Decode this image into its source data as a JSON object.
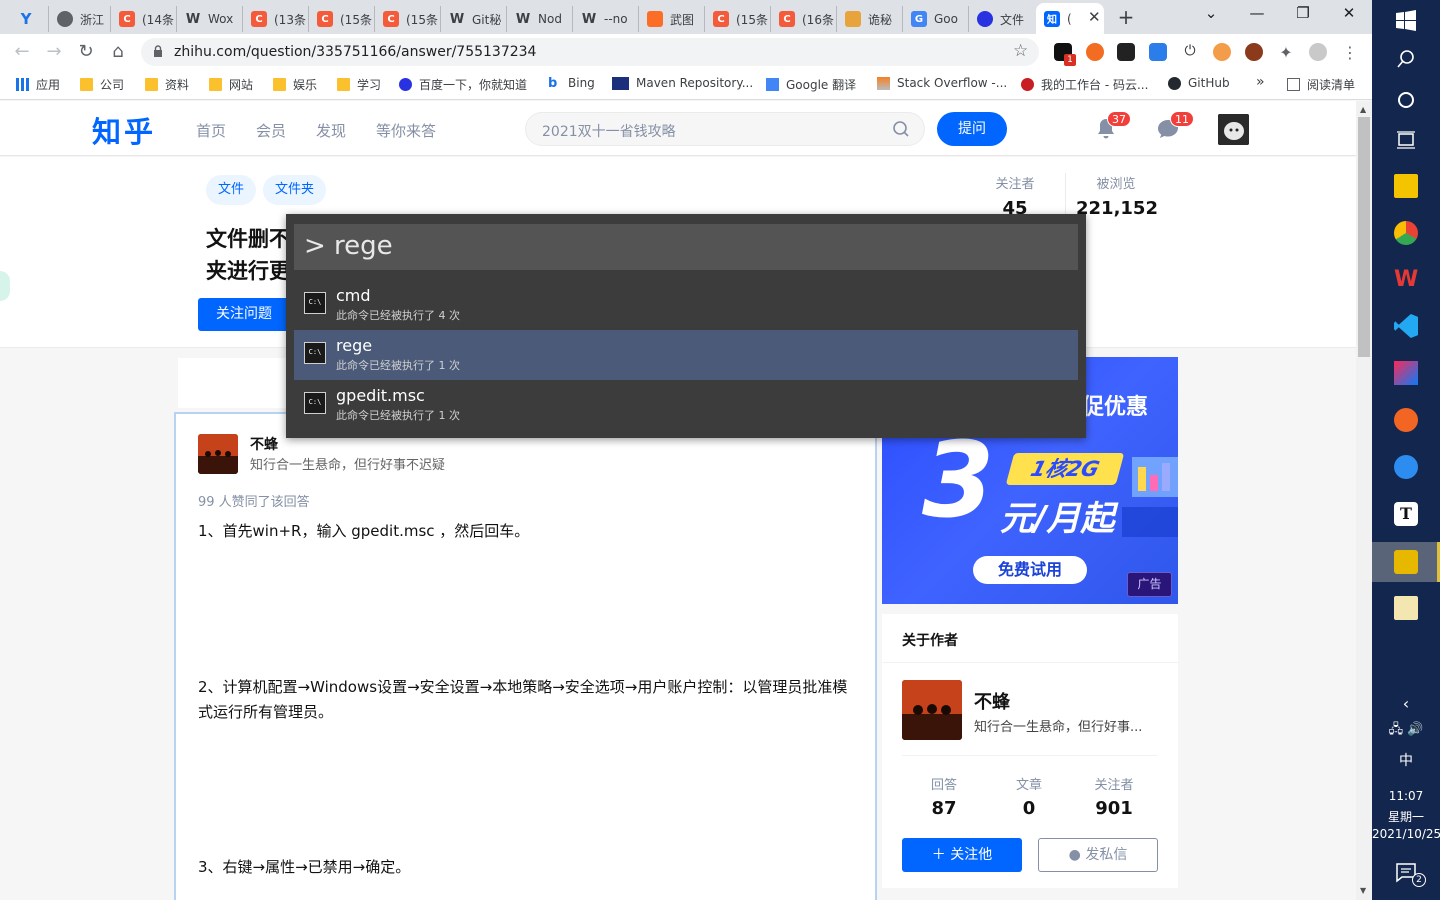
{
  "browser": {
    "tabs": [
      {
        "label": "浙江",
        "icon": "tab-favicon-circle"
      },
      {
        "label": "(14条",
        "icon": "csdn-icon"
      },
      {
        "label": "Wox",
        "icon": "tab-favicon-w"
      },
      {
        "label": "(13条",
        "icon": "csdn-icon"
      },
      {
        "label": "(15条",
        "icon": "csdn-icon"
      },
      {
        "label": "(15条",
        "icon": "csdn-icon"
      },
      {
        "label": "Git秘",
        "icon": "tab-favicon-w"
      },
      {
        "label": "Nod",
        "icon": "tab-favicon-w"
      },
      {
        "label": "--no",
        "icon": "tab-favicon-w"
      },
      {
        "label": "武图",
        "icon": "gitlab-icon"
      },
      {
        "label": "(15条",
        "icon": "csdn-icon"
      },
      {
        "label": "(16条",
        "icon": "csdn-icon"
      },
      {
        "label": "诡秘",
        "icon": "tab-favicon-house"
      },
      {
        "label": "Goo",
        "icon": "google-translate-icon"
      },
      {
        "label": "文件",
        "icon": "baidu-icon"
      },
      {
        "label": "(",
        "icon": "zhihu-icon"
      }
    ],
    "first_tab_icon": "y-icon",
    "active_tab_index": 15,
    "url": "zhihu.com/question/335751166/answer/755137234",
    "profile_badge": "1",
    "bookmarks": [
      {
        "label": "应用",
        "icon": "apps-grid-icon"
      },
      {
        "label": "公司",
        "icon": "folder-icon"
      },
      {
        "label": "资料",
        "icon": "folder-icon"
      },
      {
        "label": "网站",
        "icon": "folder-icon"
      },
      {
        "label": "娱乐",
        "icon": "folder-icon"
      },
      {
        "label": "学习",
        "icon": "folder-icon"
      },
      {
        "label": "百度一下，你就知道",
        "icon": "baidu-icon"
      },
      {
        "label": "Bing",
        "icon": "bing-icon"
      },
      {
        "label": "Maven Repository...",
        "icon": "maven-icon"
      },
      {
        "label": "Google 翻译",
        "icon": "google-translate-icon"
      },
      {
        "label": "Stack Overflow -...",
        "icon": "stackoverflow-icon"
      },
      {
        "label": "我的工作台 - 码云...",
        "icon": "gitee-icon"
      },
      {
        "label": "GitHub",
        "icon": "github-icon"
      }
    ],
    "bookmarks_more": "»",
    "reading_list": "阅读清单"
  },
  "zhihu": {
    "logo": "知乎",
    "nav": [
      "首页",
      "会员",
      "发现",
      "等你来答"
    ],
    "search_placeholder": "2021双十一省钱攻略",
    "ask_button": "提问",
    "notifications_badge": "37",
    "messages_badge": "11",
    "topics": [
      "文件",
      "文件夹"
    ],
    "question_title_line1": "文件删不",
    "question_title_line2": "夹进行更",
    "follow_question": "关注问题",
    "stats": [
      {
        "label": "关注者",
        "value": "45"
      },
      {
        "label": "被浏览",
        "value": "221,152"
      }
    ],
    "answer": {
      "author": "不蜂",
      "bio": "知行合一生悬命，但行好事不迟疑",
      "votes": "99 人赞同了该回答",
      "paragraphs": [
        "1、首先win+R，输入 gpedit.msc ，然后回车。",
        "2、计算机配置→Windows设置→安全设置→本地策略→安全选项→用户账户控制：以管理员批准模式运行所有管理员。",
        "3、右键→属性→已禁用→确定。"
      ]
    },
    "ad": {
      "headline": "促优惠",
      "big_number": "3",
      "spec": "1核2G",
      "price": "元/月起",
      "try_button": "免费试用",
      "tag": "广告"
    },
    "about_author": {
      "title": "关于作者",
      "name": "不蜂",
      "bio": "知行合一生悬命，但行好事...",
      "stats": [
        {
          "label": "回答",
          "value": "87"
        },
        {
          "label": "文章",
          "value": "0"
        },
        {
          "label": "关注者",
          "value": "901"
        }
      ],
      "follow_button": "关注他",
      "message_button": "发私信"
    }
  },
  "launcher": {
    "query": "> rege",
    "results": [
      {
        "title": "cmd",
        "subtitle": "此命令已经被执行了 4 次",
        "selected": false
      },
      {
        "title": "rege",
        "subtitle": "此命令已经被执行了 1 次",
        "selected": true
      },
      {
        "title": "gpedit.msc",
        "subtitle": "此命令已经被执行了 1 次",
        "selected": false
      }
    ]
  },
  "taskbar": {
    "input_method": "中",
    "time": "11:07",
    "weekday": "星期一",
    "date": "2021/10/25",
    "notification_count": "2"
  },
  "colors": {
    "zhihu_blue": "#0066ff",
    "taskbar_bg": "#13264d",
    "launcher_bg": "#3c3c3c",
    "launcher_selected": "#4a5a78",
    "badge_red": "#f1403c"
  }
}
